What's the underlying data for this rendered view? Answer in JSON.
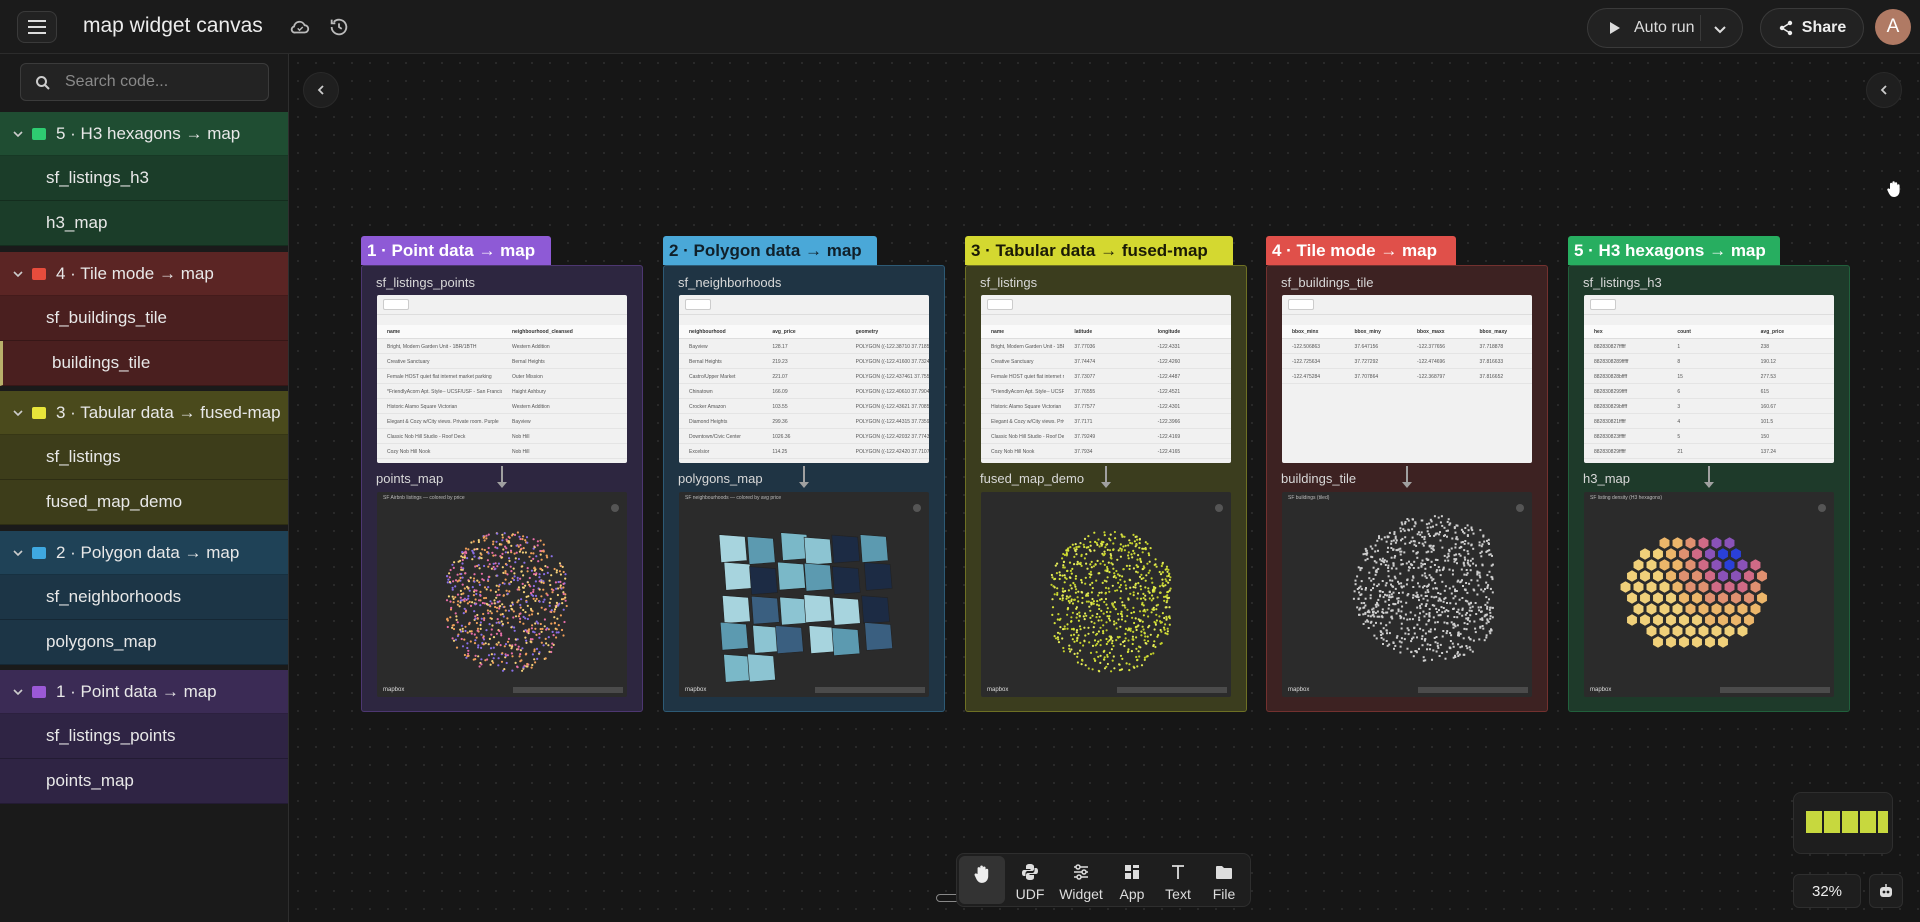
{
  "header": {
    "app_title": "map widget canvas",
    "autorun_label": "Auto run",
    "share_label": "Share",
    "avatar_initial": "A"
  },
  "search": {
    "placeholder": "Search code..."
  },
  "sidebar": {
    "groups": [
      {
        "label": "5 · H3 hexagons → map",
        "color": "#2ecc71",
        "items": [
          "sf_listings_h3",
          "h3_map"
        ]
      },
      {
        "label": "4 · Tile mode → map",
        "color": "#e74c3c",
        "items": [
          "sf_buildings_tile",
          "buildings_tile"
        ]
      },
      {
        "label": "3 · Tabular data → fused-map",
        "color": "#e8e53a",
        "items": [
          "sf_listings",
          "fused_map_demo"
        ]
      },
      {
        "label": "2 · Polygon data → map",
        "color": "#3fa8e0",
        "items": [
          "sf_neighborhoods",
          "polygons_map"
        ]
      },
      {
        "label": "1 · Point data → map",
        "color": "#9b59d6",
        "items": [
          "sf_listings_points",
          "points_map"
        ]
      }
    ]
  },
  "panels": [
    {
      "tag": "1 · Point data → map",
      "tag_color": "#8e5ad6",
      "bg": "#2d2640",
      "table_node": "sf_listings_points",
      "map_node": "points_map",
      "columns": [
        "name",
        "neighbourhood_cleansed"
      ],
      "rows": [
        [
          "Bright, Modern Garden Unit - 1BR/1BTH",
          "Western Addition"
        ],
        [
          "Creative Sanctuary",
          "Bernal Heights"
        ],
        [
          "Female HOST quiet flat internet market parking",
          "Outer Mission"
        ],
        [
          "*FriendlyAcorn Apt. Style-- UCSF/USF - San Francisco",
          "Haight Ashbury"
        ],
        [
          "Historic Alamo Square Victorian",
          "Western Addition"
        ],
        [
          "Elegant & Cozy w/City views. Private room. Purple",
          "Bayview"
        ],
        [
          "Classic Nob Hill Studio - Roof Deck",
          "Nob Hill"
        ],
        [
          "Cozy Nob Hill Nook",
          "Nob Hill"
        ]
      ],
      "map_caption": "SF Airbnb listings — colored by price",
      "map_logo": "mapbox"
    },
    {
      "tag": "2 · Polygon data → map",
      "tag_color": "#4aa8d8",
      "bg": "#1f3444",
      "table_node": "sf_neighborhoods",
      "map_node": "polygons_map",
      "columns": [
        "neighbourhood",
        "avg_price",
        "geometry"
      ],
      "rows": [
        [
          "Bayview",
          "128.17",
          "POLYGON ((-122.38710 37.71850, -122"
        ],
        [
          "Bernal Heights",
          "219.23",
          "POLYGON ((-122.41600 37.73244, -122"
        ],
        [
          "Castro/Upper Market",
          "221.07",
          "POLYGON ((-122.437461 37.755880"
        ],
        [
          "Chinatown",
          "166.09",
          "POLYGON ((-122.40610 37.7904, -122.4"
        ],
        [
          "Crocker Amazon",
          "103.55",
          "POLYGON ((-122.43621 37.70851, -122"
        ],
        [
          "Diamond Heights",
          "299.36",
          "POLYGON ((-122.44315 37.73591, -122"
        ],
        [
          "Downtown/Civic Center",
          "1026.36",
          "POLYGON ((-122.42032 37.77433, -122"
        ],
        [
          "Excelsior",
          "114.25",
          "POLYGON ((-122.42420 37.71071, 37.71"
        ]
      ],
      "map_caption": "SF neighbourhoods — colored by avg price",
      "map_logo": "mapbox"
    },
    {
      "tag": "3 · Tabular data → fused-map",
      "tag_color": "#d4d830",
      "bg": "#3b3d1e",
      "table_node": "sf_listings",
      "map_node": "fused_map_demo",
      "columns": [
        "name",
        "latitude",
        "longitude"
      ],
      "rows": [
        [
          "Bright, Modern Garden Unit - 1BR/1BTH",
          "37.77036",
          "-122.4331"
        ],
        [
          "Creative Sanctuary",
          "37.74474",
          "-122.4260"
        ],
        [
          "Female HOST quiet flat internet market parking",
          "37.73077",
          "-122.4487"
        ],
        [
          "*FriendlyAcorn Apt. Style-- UCSF/USF - San Francisco",
          "37.76555",
          "-122.4521"
        ],
        [
          "Historic Alamo Square Victorian",
          "37.77577",
          "-122.4301"
        ],
        [
          "Elegant & Cozy w/City views. Private room. Purple",
          "37.7171",
          "-122.3966"
        ],
        [
          "Classic Nob Hill Studio - Roof Deck",
          "37.79249",
          "-122.4169"
        ],
        [
          "Cozy Nob Hill Nook",
          "37.7934",
          "-122.4165"
        ]
      ],
      "map_caption": "",
      "map_logo": "mapbox"
    },
    {
      "tag": "4 · Tile mode → map",
      "tag_color": "#e0504a",
      "bg": "#3d2222",
      "table_node": "sf_buildings_tile",
      "map_node": "buildings_tile",
      "columns": [
        "bbox_minx",
        "bbox_miny",
        "bbox_maxx",
        "bbox_maxy"
      ],
      "rows": [
        [
          "-122.506863",
          "37.647156",
          "-122.377656",
          "37.718878"
        ],
        [
          "-122.725634",
          "37.727292",
          "-122.474696",
          "37.816633"
        ],
        [
          "-122.475284",
          "37.707864",
          "-122.368797",
          "37.816652"
        ]
      ],
      "map_caption": "SF buildings (tiled)",
      "map_logo": "mapbox"
    },
    {
      "tag": "5 · H3 hexagons → map",
      "tag_color": "#27ae60",
      "bg": "#1e3a2a",
      "table_node": "sf_listings_h3",
      "map_node": "h3_map",
      "columns": [
        "hex",
        "count",
        "avg_price"
      ],
      "rows": [
        [
          "882830827fffff",
          "1",
          "238"
        ],
        [
          "8828308289fffff",
          "8",
          "190.12"
        ],
        [
          "882830828bffff",
          "15",
          "277.53"
        ],
        [
          "8828308299ffff",
          "6",
          "615"
        ],
        [
          "882830829bffff",
          "3",
          "160.67"
        ],
        [
          "882830821fffff",
          "4",
          "101.5"
        ],
        [
          "882830823fffff",
          "5",
          "150"
        ],
        [
          "882830829fffff",
          "21",
          "137.24"
        ]
      ],
      "map_caption": "SF listing density (H3 hexagons)",
      "map_logo": "mapbox"
    }
  ],
  "toolbar": {
    "tools": [
      "UDF",
      "Widget",
      "App",
      "Text",
      "File"
    ]
  },
  "zoom_level": "32%"
}
